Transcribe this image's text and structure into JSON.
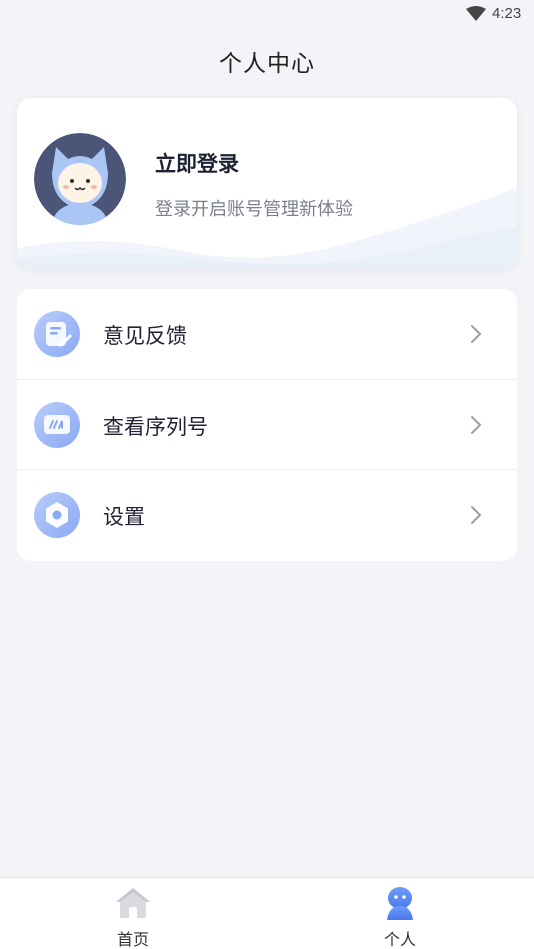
{
  "status_bar": {
    "time": "4:23"
  },
  "header": {
    "title": "个人中心"
  },
  "login_card": {
    "title": "立即登录",
    "subtitle": "登录开启账号管理新体验"
  },
  "menu": {
    "items": [
      {
        "label": "意见反馈",
        "icon": "feedback-icon"
      },
      {
        "label": "查看序列号",
        "icon": "serial-number-icon"
      },
      {
        "label": "设置",
        "icon": "settings-icon"
      }
    ]
  },
  "bottom_nav": {
    "items": [
      {
        "label": "首页",
        "icon": "home-icon",
        "active": false
      },
      {
        "label": "个人",
        "icon": "profile-icon",
        "active": true
      }
    ]
  },
  "colors": {
    "accent": "#5b8cf5",
    "background": "#f3f4f8",
    "avatar_bg": "#4a5578"
  }
}
